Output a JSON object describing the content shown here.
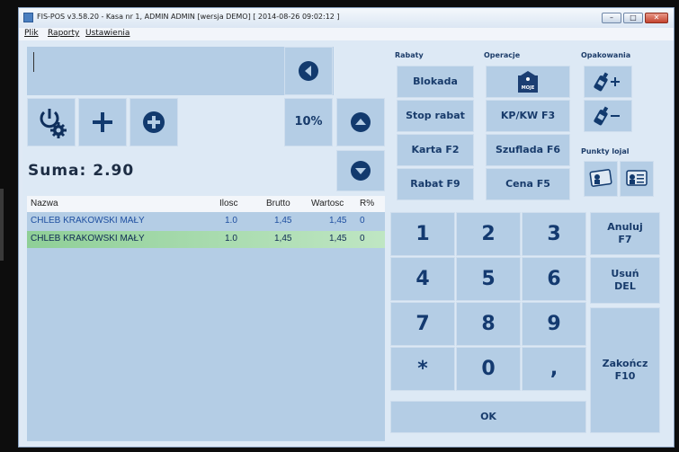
{
  "window": {
    "title": "FIS-POS v3.58.20 - Kasa nr 1, ADMIN ADMIN [wersja DEMO]  [ 2014-08-26 09:02:12 ]",
    "controls": {
      "minimize": "–",
      "maximize": "□",
      "close": "✕"
    }
  },
  "menu": [
    "Plik",
    "Raporty",
    "Ustawienia"
  ],
  "pos": {
    "input_value": "",
    "percent_button": "10%",
    "sum_label": "Suma: 2.90"
  },
  "table": {
    "headers": [
      "Nazwa",
      "Ilosc",
      "Brutto",
      "Wartosc",
      "R%"
    ],
    "rows": [
      [
        "CHLEB KRAKOWSKI MAŁY",
        "1.0",
        "1,45",
        "1,45",
        "0"
      ],
      [
        "CHLEB KRAKOWSKI MAŁY",
        "1.0",
        "1,45",
        "1,45",
        "0"
      ]
    ]
  },
  "sections": {
    "rabaty": "Rabaty",
    "operacje": "Operacje",
    "opakowania": "Opakowania",
    "punkty": "Punkty lojal"
  },
  "buttons": {
    "blokada": "Blokada",
    "stop_rabat": "Stop rabat",
    "karta": "Karta F2",
    "rabat": "Rabat F9",
    "kpkw": "KP/KW F3",
    "szuflada": "Szuflada F6",
    "cena": "Cena F5",
    "anuluj_1": "Anuluj",
    "anuluj_2": "F7",
    "usun_1": "Usuń",
    "usun_2": "DEL",
    "zakoncz_1": "Zakończ",
    "zakoncz_2": "F10",
    "ok": "OK",
    "logo_text": "MOJE"
  },
  "keypad": [
    "1",
    "2",
    "3",
    "4",
    "5",
    "6",
    "7",
    "8",
    "9",
    "*",
    "0",
    ","
  ],
  "colors": {
    "tile": "#b4cde5",
    "row_selected": "#9bd3a1",
    "text_blue": "#1f4fa0"
  }
}
